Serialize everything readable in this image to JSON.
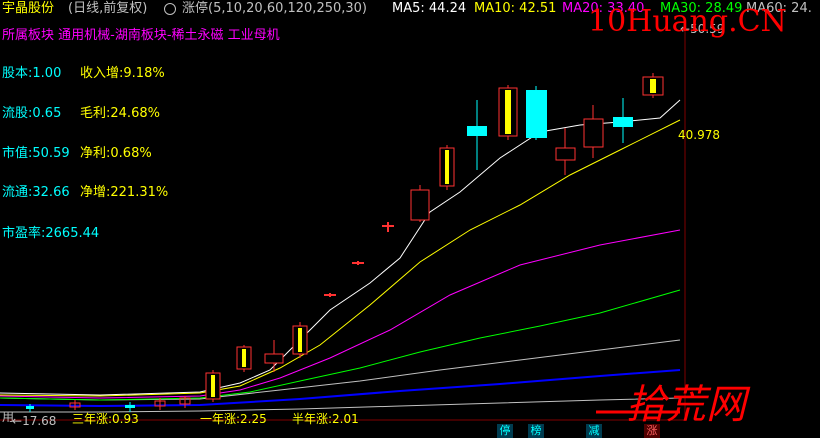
{
  "header": {
    "stock_name": "宇晶股份",
    "period": "(日线,前复权)",
    "indicator": "涨停(5,10,20,60,120,250,30)",
    "ma5": {
      "label": "MA5:",
      "value": "44.24",
      "color": "#ffffff"
    },
    "ma10": {
      "label": "MA10:",
      "value": "42.51",
      "color": "#ffff00"
    },
    "ma20": {
      "label": "MA20:",
      "value": "33.40",
      "color": "#ff00ff"
    },
    "ma30": {
      "label": "MA30:",
      "value": "28.49",
      "color": "#00ff00"
    },
    "ma60": {
      "label": "MA60:",
      "value": "24.",
      "color": "#c0c0c0"
    }
  },
  "sectors": "所属板块 通用机械-湖南板块-稀土永磁 工业母机",
  "fundamentals": [
    {
      "label": "股本:",
      "value": "1.00",
      "label2": "收入增:",
      "value2": "9.18%"
    },
    {
      "label": "流股:",
      "value": "0.65",
      "label2": "毛利:",
      "value2": "24.68%"
    },
    {
      "label": "市值:",
      "value": "50.59",
      "label2": "净利:",
      "value2": "0.68%"
    },
    {
      "label": "流通:",
      "value": "32.66",
      "label2": "净增:",
      "value2": "221.31%"
    },
    {
      "label": "市盈率:",
      "value": "2665.44"
    }
  ],
  "price_labels": {
    "high": "50.59",
    "ma_value": "40.978",
    "low": "17.68"
  },
  "bottom_stats": {
    "three_year": "三年涨:0.93",
    "one_year": "一年涨:2.25",
    "half_year": "半年涨:2.01",
    "prefix": "用"
  },
  "bottom_tags": [
    "停",
    "榜",
    "减",
    "涨"
  ],
  "watermark": {
    "site": "10Huang.CN",
    "logo_text": "拾荒网"
  },
  "colors": {
    "up": "#ff3232",
    "down": "#00ffff",
    "limit_up": "#ffff00",
    "text": "#c0c0c0"
  }
}
